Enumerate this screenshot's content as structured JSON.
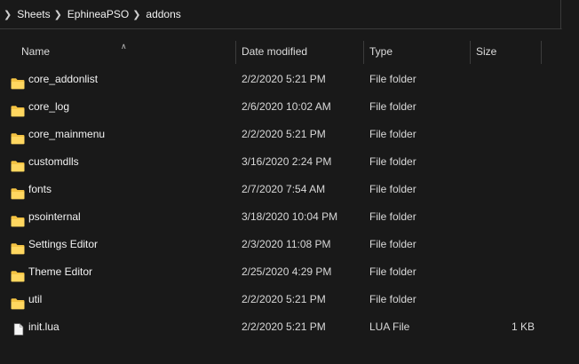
{
  "breadcrumb": [
    "Sheets",
    "EphineaPSO",
    "addons"
  ],
  "columns": {
    "name": "Name",
    "date": "Date modified",
    "type": "Type",
    "size": "Size"
  },
  "rows": [
    {
      "icon": "folder-icon",
      "name": "core_addonlist",
      "date": "2/2/2020 5:21 PM",
      "type": "File folder",
      "size": ""
    },
    {
      "icon": "folder-icon",
      "name": "core_log",
      "date": "2/6/2020 10:02 AM",
      "type": "File folder",
      "size": ""
    },
    {
      "icon": "folder-icon",
      "name": "core_mainmenu",
      "date": "2/2/2020 5:21 PM",
      "type": "File folder",
      "size": ""
    },
    {
      "icon": "folder-icon",
      "name": "customdlls",
      "date": "3/16/2020 2:24 PM",
      "type": "File folder",
      "size": ""
    },
    {
      "icon": "folder-icon",
      "name": "fonts",
      "date": "2/7/2020 7:54 AM",
      "type": "File folder",
      "size": ""
    },
    {
      "icon": "folder-icon",
      "name": "psointernal",
      "date": "3/18/2020 10:04 PM",
      "type": "File folder",
      "size": ""
    },
    {
      "icon": "folder-icon",
      "name": "Settings Editor",
      "date": "2/3/2020 11:08 PM",
      "type": "File folder",
      "size": ""
    },
    {
      "icon": "folder-icon",
      "name": "Theme Editor",
      "date": "2/25/2020 4:29 PM",
      "type": "File folder",
      "size": ""
    },
    {
      "icon": "folder-icon",
      "name": "util",
      "date": "2/2/2020 5:21 PM",
      "type": "File folder",
      "size": ""
    },
    {
      "icon": "file-icon",
      "name": "init.lua",
      "date": "2/2/2020 5:21 PM",
      "type": "LUA File",
      "size": "1 KB"
    }
  ],
  "colors": {
    "background": "#191919",
    "folder": "#f4c343",
    "text": "#f2f2f2"
  }
}
